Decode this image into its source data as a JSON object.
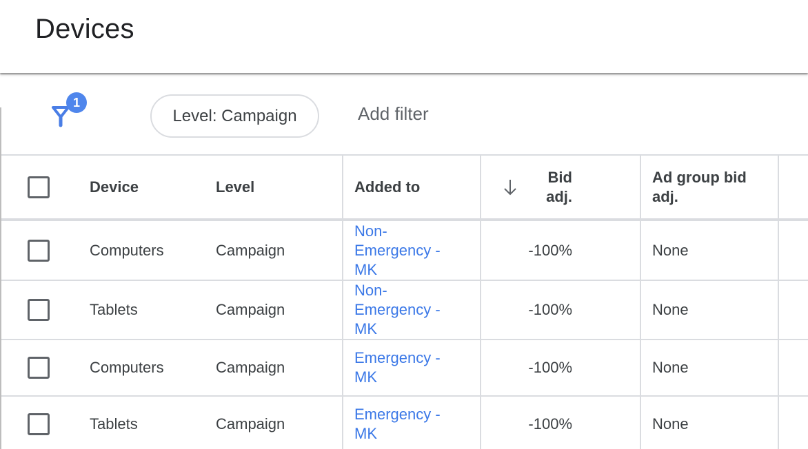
{
  "header": {
    "title": "Devices"
  },
  "filters": {
    "filter_icon": "filter-icon",
    "active_count": "1",
    "chips": [
      {
        "label": "Level: Campaign"
      }
    ],
    "add_filter_label": "Add filter"
  },
  "table": {
    "columns": {
      "device": "Device",
      "level": "Level",
      "added_to": "Added to",
      "bid_adj": "Bid adj.",
      "bid_adj_line1": "Bid",
      "bid_adj_line2": "adj.",
      "bid_sort": "descending",
      "ad_group_bid_adj_line1": "Ad group bid",
      "ad_group_bid_adj_line2": "adj."
    },
    "rows": [
      {
        "device": "Computers",
        "level": "Campaign",
        "added_to": "Non-Emergency - MK",
        "added_to_l1": "Non-",
        "added_to_l2": "Emergency -",
        "added_to_l3": "MK",
        "bid_adj": "-100%",
        "ad_group_bid_adj": "None"
      },
      {
        "device": "Tablets",
        "level": "Campaign",
        "added_to": "Non-Emergency - MK",
        "added_to_l1": "Non-",
        "added_to_l2": "Emergency -",
        "added_to_l3": "MK",
        "bid_adj": "-100%",
        "ad_group_bid_adj": "None"
      },
      {
        "device": "Computers",
        "level": "Campaign",
        "added_to": "Emergency - MK",
        "added_to_l1": "Emergency -",
        "added_to_l2": "MK",
        "bid_adj": "-100%",
        "ad_group_bid_adj": "None"
      },
      {
        "device": "Tablets",
        "level": "Campaign",
        "added_to": "Emergency - MK",
        "added_to_l1": "Emergency -",
        "added_to_l2": "MK",
        "bid_adj": "-100%",
        "ad_group_bid_adj": "None"
      }
    ]
  },
  "colors": {
    "accent": "#4f86ec",
    "link": "#3b78e7",
    "text": "#3c4043",
    "border": "#dadce0"
  }
}
